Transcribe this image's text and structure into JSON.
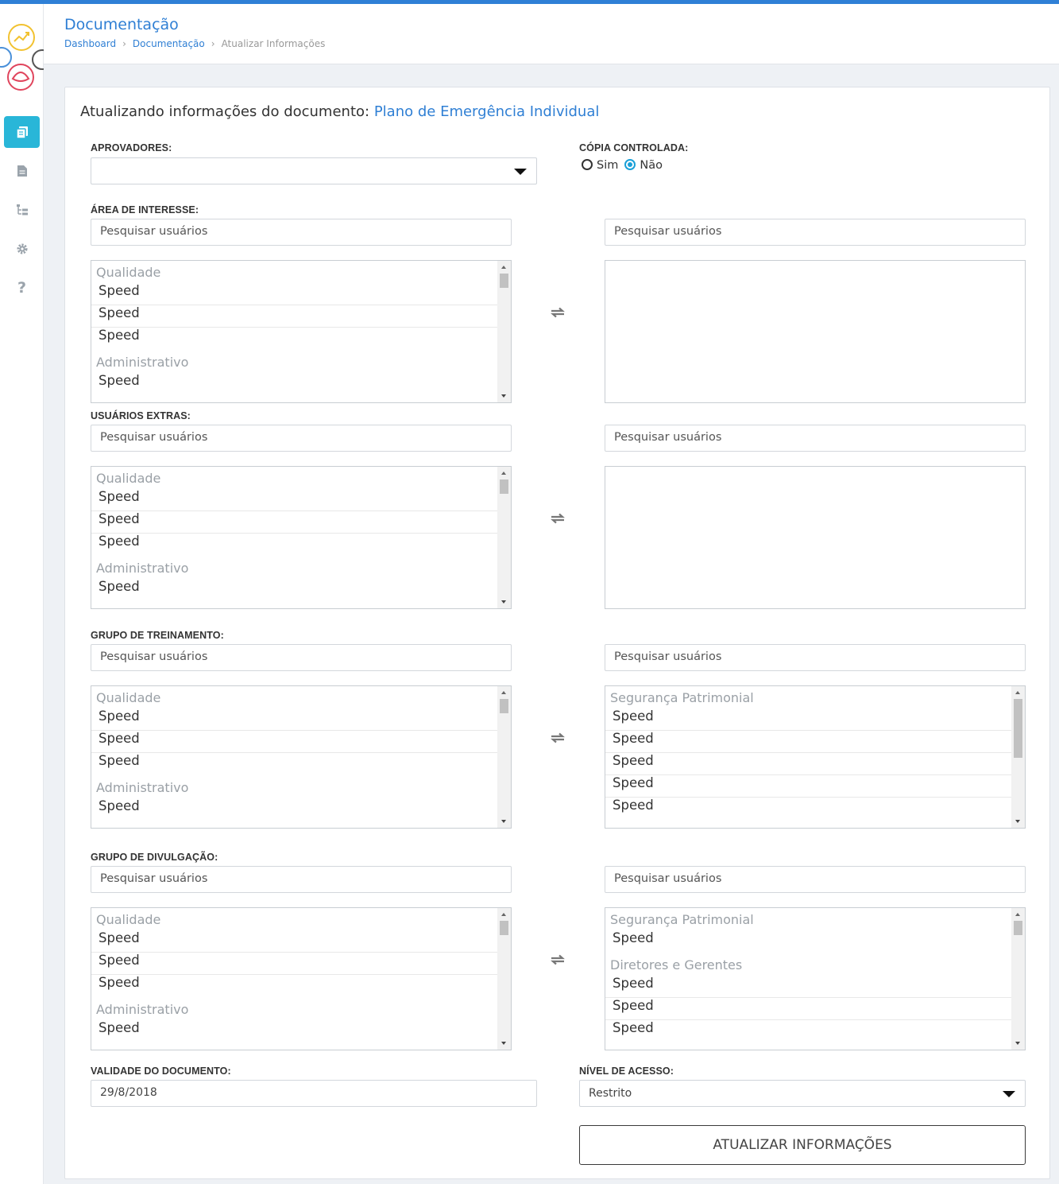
{
  "header": {
    "title": "Documentação",
    "breadcrumb": [
      "Dashboard",
      "Documentação",
      "Atualizar Informações"
    ]
  },
  "sidebar": {
    "items": [
      {
        "icon": "documents-icon",
        "active": true
      },
      {
        "icon": "file-icon"
      },
      {
        "icon": "tree-icon"
      },
      {
        "icon": "gear-icon"
      },
      {
        "icon": "help-icon"
      }
    ]
  },
  "form": {
    "title_prefix": "Atualizando informações do documento:",
    "document_name": "Plano de Emergência Individual",
    "approvers_label": "APROVADORES:",
    "approvers_value": "",
    "controlled_copy_label": "CÓPIA CONTROLADA:",
    "controlled_copy_options": [
      "Sim",
      "Não"
    ],
    "controlled_copy_selected": "Não",
    "search_placeholder": "Pesquisar usuários",
    "sections": [
      {
        "label": "ÁREA DE INTERESSE:",
        "left": [
          {
            "group": "Qualidade",
            "items": [
              "Speed",
              "Speed",
              "Speed"
            ]
          },
          {
            "group": "Administrativo",
            "items": [
              "Speed"
            ]
          }
        ],
        "right": []
      },
      {
        "label": "USUÁRIOS EXTRAS:",
        "left": [
          {
            "group": "Qualidade",
            "items": [
              "Speed",
              "Speed",
              "Speed"
            ]
          },
          {
            "group": "Administrativo",
            "items": [
              "Speed"
            ]
          }
        ],
        "right": []
      },
      {
        "label": "GRUPO DE TREINAMENTO:",
        "left": [
          {
            "group": "Qualidade",
            "items": [
              "Speed",
              "Speed",
              "Speed"
            ]
          },
          {
            "group": "Administrativo",
            "items": [
              "Speed"
            ]
          }
        ],
        "right": [
          {
            "group": "Segurança Patrimonial",
            "items": [
              "Speed",
              "Speed",
              "Speed",
              "Speed",
              "Speed"
            ]
          }
        ]
      },
      {
        "label": "GRUPO DE DIVULGAÇÃO:",
        "left": [
          {
            "group": "Qualidade",
            "items": [
              "Speed",
              "Speed",
              "Speed"
            ]
          },
          {
            "group": "Administrativo",
            "items": [
              "Speed"
            ]
          }
        ],
        "right": [
          {
            "group": "Segurança Patrimonial",
            "items": [
              "Speed"
            ]
          },
          {
            "group": "Diretores e Gerentes",
            "items": [
              "Speed",
              "Speed",
              "Speed"
            ]
          }
        ]
      }
    ],
    "validity_label": "VALIDADE DO DOCUMENTO:",
    "validity_value": "29/8/2018",
    "access_label": "NÍVEL DE ACESSO:",
    "access_value": "Restrito",
    "submit_label": "ATUALIZAR INFORMAÇÕES"
  },
  "colors": {
    "accent": "#2f80d6",
    "sidebar_active": "#29b6d8",
    "radio_checked": "#1aa0d8"
  }
}
